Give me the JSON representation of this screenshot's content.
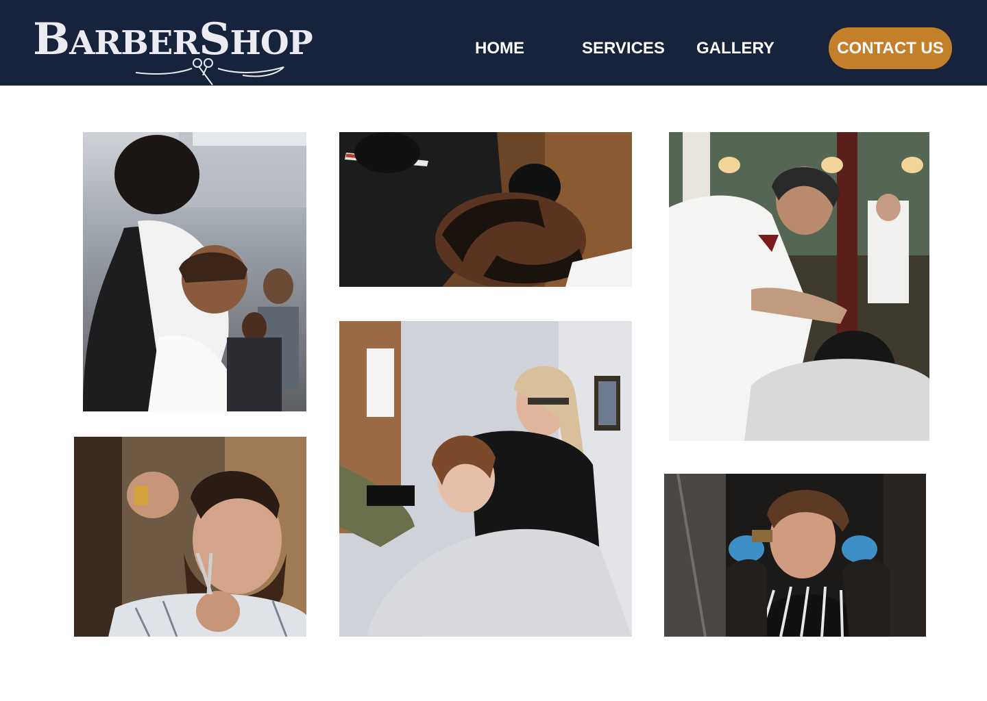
{
  "brand": {
    "logo_text_first": "B",
    "logo_text_mid": "ARBER",
    "logo_text_second": "S",
    "logo_text_end": "HOP",
    "colors": {
      "header_bg": "#17233b",
      "accent": "#c47f2b",
      "text": "#ffffff"
    }
  },
  "nav": {
    "items": [
      {
        "label": "HOME"
      },
      {
        "label": "SERVICES"
      },
      {
        "label": "GALLERY"
      }
    ],
    "contact_label": "CONTACT US"
  },
  "gallery": {
    "photos": [
      {
        "name": "barber-on-phone-photo"
      },
      {
        "name": "beard-razor-trim-photo"
      },
      {
        "name": "vintage-barber-shave-photo"
      },
      {
        "name": "beard-scissor-trim-photo"
      },
      {
        "name": "female-barber-haircut-photo"
      },
      {
        "name": "fade-clipper-haircut-photo"
      }
    ]
  }
}
